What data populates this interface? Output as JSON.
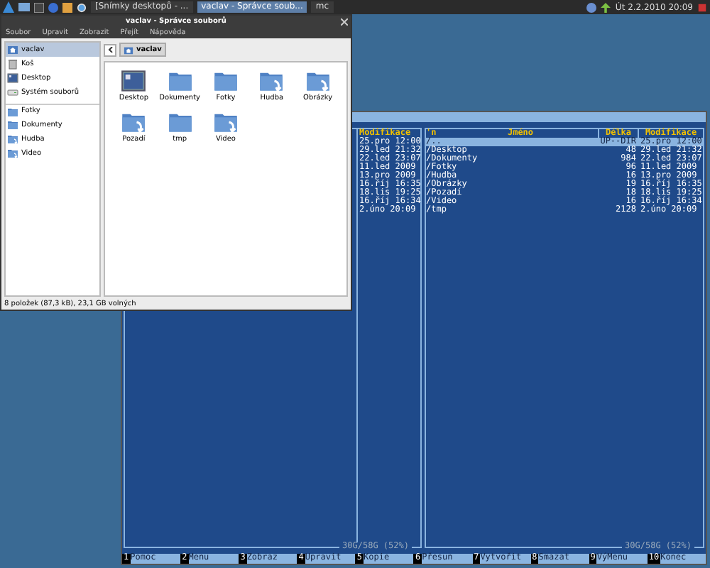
{
  "taskbar": {
    "tasks": [
      {
        "label": "[Snímky desktopů - ...",
        "selected": false
      },
      {
        "label": "vaclav - Správce soub...",
        "selected": true
      },
      {
        "label": "mc",
        "selected": false
      }
    ],
    "clock": "Út 2.2.2010 20:09"
  },
  "file_manager": {
    "title": "vaclav - Správce souborů",
    "menu": [
      "Soubor",
      "Upravit",
      "Zobrazit",
      "Přejít",
      "Nápověda"
    ],
    "sidebar": [
      {
        "label": "vaclav",
        "kind": "home",
        "selected": true
      },
      {
        "label": "Koš",
        "kind": "trash",
        "selected": false
      },
      {
        "label": "Desktop",
        "kind": "desktop",
        "selected": false
      },
      {
        "label": "Systém souborů",
        "kind": "drive",
        "selected": false
      },
      {
        "label": "Fotky",
        "kind": "folder",
        "selected": false
      },
      {
        "label": "Dokumenty",
        "kind": "folder",
        "selected": false
      },
      {
        "label": "Hudba",
        "kind": "link",
        "selected": false
      },
      {
        "label": "Video",
        "kind": "link",
        "selected": false
      }
    ],
    "path": "vaclav",
    "items": [
      {
        "label": "Desktop",
        "kind": "desktop"
      },
      {
        "label": "Dokumenty",
        "kind": "folder"
      },
      {
        "label": "Fotky",
        "kind": "folder"
      },
      {
        "label": "Hudba",
        "kind": "link"
      },
      {
        "label": "Obrázky",
        "kind": "link"
      },
      {
        "label": "Pozadí",
        "kind": "link"
      },
      {
        "label": "tmp",
        "kind": "folder"
      },
      {
        "label": "Video",
        "kind": "link"
      }
    ],
    "status": "8 položek (87,3 kB), 23,1 GB volných"
  },
  "mc": {
    "left_panel": {
      "column": "Modifikace",
      "rows": [
        "25.pro 12:00",
        "29.led 21:32",
        "22.led 23:07",
        "11.led 2009",
        "13.pro 2009",
        "16.říj 16:35",
        "18.lis 19:25",
        "16.říj 16:34",
        "2.úno 20:09"
      ],
      "free": "30G/58G (52%)"
    },
    "right_panel": {
      "columns": [
        "'n",
        "Jméno",
        "Délka",
        "Modifikace"
      ],
      "rows": [
        {
          "name": "/..",
          "size": "UP--DIR",
          "date": "25.pro 12:00",
          "selected": true
        },
        {
          "name": "/Desktop",
          "size": "48",
          "date": "29.led 21:32",
          "selected": false
        },
        {
          "name": "/Dokumenty",
          "size": "984",
          "date": "22.led 23:07",
          "selected": false
        },
        {
          "name": "/Fotky",
          "size": "96",
          "date": "11.led 2009",
          "selected": false
        },
        {
          "name": "/Hudba",
          "size": "16",
          "date": "13.pro 2009",
          "selected": false
        },
        {
          "name": "/Obrázky",
          "size": "19",
          "date": "16.říj 16:35",
          "selected": false
        },
        {
          "name": "/Pozadí",
          "size": "18",
          "date": "18.lis 19:25",
          "selected": false
        },
        {
          "name": "/Video",
          "size": "16",
          "date": "16.říj 16:34",
          "selected": false
        },
        {
          "name": "/tmp",
          "size": "2128",
          "date": "2.úno 20:09",
          "selected": false
        }
      ],
      "free": "30G/58G (52%)"
    },
    "keys": [
      {
        "num": "1",
        "label": "Pomoc"
      },
      {
        "num": "2",
        "label": "Menu"
      },
      {
        "num": "3",
        "label": "Zobraz"
      },
      {
        "num": "4",
        "label": "Upravit"
      },
      {
        "num": "5",
        "label": "Kopie"
      },
      {
        "num": "6",
        "label": "Přesun"
      },
      {
        "num": "7",
        "label": "Vytvořit"
      },
      {
        "num": "8",
        "label": "Smazat"
      },
      {
        "num": "9",
        "label": "VýMenu"
      },
      {
        "num": "10",
        "label": "Konec"
      }
    ]
  }
}
